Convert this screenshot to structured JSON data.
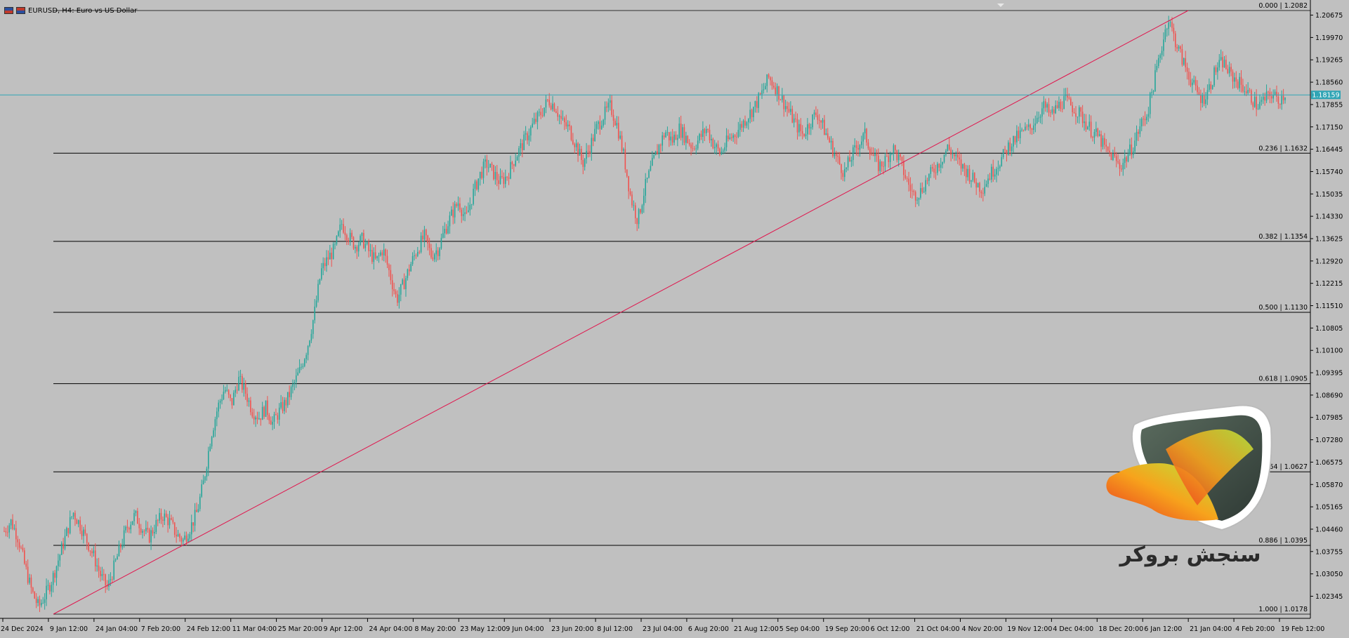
{
  "header": {
    "title": "EURUSD, H4:  Euro vs US Dollar"
  },
  "colors": {
    "background": "#c0c0c0",
    "bull_candle": "#26a69a",
    "bear_candle": "#ef5350",
    "trend_line": "#e0144c",
    "fib_line": "#000000",
    "current_price_line": "#30a5b5"
  },
  "chart_data": {
    "type": "candlestick",
    "symbol": "EURUSD",
    "timeframe": "H4",
    "ylim": [
      1.0178,
      1.2082
    ],
    "y_ticks": [
      "1.20675",
      "1.19970",
      "1.19265",
      "1.18560",
      "1.17855",
      "1.17150",
      "1.16445",
      "1.15740",
      "1.15035",
      "1.14330",
      "1.13625",
      "1.12920",
      "1.12215",
      "1.11510",
      "1.10805",
      "1.10100",
      "1.09395",
      "1.08690",
      "1.07985",
      "1.07280",
      "1.06575",
      "1.05870",
      "1.05165",
      "1.04460",
      "1.03755",
      "1.03050",
      "1.02345"
    ],
    "x_ticks": [
      "24 Dec 2024",
      "9 Jan 12:00",
      "24 Jan 04:00",
      "7 Feb 20:00",
      "24 Feb 12:00",
      "11 Mar 04:00",
      "25 Mar 20:00",
      "9 Apr 12:00",
      "24 Apr 04:00",
      "8 May 20:00",
      "23 May 12:00",
      "9 Jun 04:00",
      "23 Jun 20:00",
      "8 Jul 12:00",
      "23 Jul 04:00",
      "6 Aug 20:00",
      "21 Aug 12:00",
      "5 Sep 04:00",
      "19 Sep 20:00",
      "6 Oct 12:00",
      "21 Oct 04:00",
      "4 Nov 20:00",
      "19 Nov 12:00",
      "4 Dec 04:00",
      "18 Dec 20:00",
      "6 Jan 12:00",
      "21 Jan 04:00",
      "4 Feb 20:00",
      "19 Feb 12:00"
    ],
    "current_price": "1.18159",
    "fibonacci": [
      {
        "ratio": "0.000",
        "price": "1.2082",
        "value": 1.2082
      },
      {
        "ratio": "0.236",
        "price": "1.1632",
        "value": 1.1632
      },
      {
        "ratio": "0.382",
        "price": "1.1354",
        "value": 1.1354
      },
      {
        "ratio": "0.500",
        "price": "1.1130",
        "value": 1.113
      },
      {
        "ratio": "0.618",
        "price": "1.0905",
        "value": 1.0905
      },
      {
        "ratio": "0.764",
        "price": "1.0627",
        "value": 1.0627
      },
      {
        "ratio": "0.886",
        "price": "1.0395",
        "value": 1.0395
      },
      {
        "ratio": "1.000",
        "price": "1.0178",
        "value": 1.0178
      }
    ],
    "trend_line": {
      "from": {
        "time": "9 Jan 12:00",
        "price": 1.0178
      },
      "to": {
        "time": "21 Jan 04:00",
        "price": 1.2082
      }
    },
    "price_path": [
      [
        0,
        1.044
      ],
      [
        0.5,
        1.047
      ],
      [
        1,
        1.042
      ],
      [
        1.5,
        1.033
      ],
      [
        2,
        1.025
      ],
      [
        2.5,
        1.02
      ],
      [
        3,
        1.024
      ],
      [
        3.5,
        1.029
      ],
      [
        4,
        1.036
      ],
      [
        4.5,
        1.043
      ],
      [
        5,
        1.05
      ],
      [
        5.5,
        1.046
      ],
      [
        6,
        1.041
      ],
      [
        6.5,
        1.036
      ],
      [
        7,
        1.03
      ],
      [
        7.5,
        1.026
      ],
      [
        8,
        1.033
      ],
      [
        8.5,
        1.04
      ],
      [
        9,
        1.046
      ],
      [
        9.5,
        1.049
      ],
      [
        10,
        1.045
      ],
      [
        10.5,
        1.042
      ],
      [
        11,
        1.046
      ],
      [
        11.5,
        1.049
      ],
      [
        12,
        1.047
      ],
      [
        12.5,
        1.043
      ],
      [
        13,
        1.041
      ],
      [
        13.5,
        1.045
      ],
      [
        14,
        1.05
      ],
      [
        14.5,
        1.06
      ],
      [
        15,
        1.074
      ],
      [
        15.5,
        1.083
      ],
      [
        16,
        1.089
      ],
      [
        16.5,
        1.084
      ],
      [
        17,
        1.092
      ],
      [
        17.5,
        1.088
      ],
      [
        18,
        1.082
      ],
      [
        18.5,
        1.08
      ],
      [
        19,
        1.083
      ],
      [
        19.5,
        1.078
      ],
      [
        20,
        1.082
      ],
      [
        20.5,
        1.085
      ],
      [
        21,
        1.09
      ],
      [
        21.5,
        1.095
      ],
      [
        22,
        1.102
      ],
      [
        22.5,
        1.112
      ],
      [
        23,
        1.126
      ],
      [
        23.5,
        1.13
      ],
      [
        24,
        1.133
      ],
      [
        24.5,
        1.141
      ],
      [
        25,
        1.137
      ],
      [
        25.5,
        1.134
      ],
      [
        26,
        1.136
      ],
      [
        26.5,
        1.132
      ],
      [
        27,
        1.129
      ],
      [
        27.5,
        1.133
      ],
      [
        28,
        1.125
      ],
      [
        28.5,
        1.117
      ],
      [
        29,
        1.122
      ],
      [
        29.5,
        1.128
      ],
      [
        30,
        1.133
      ],
      [
        30.5,
        1.137
      ],
      [
        31,
        1.131
      ],
      [
        31.5,
        1.133
      ],
      [
        32,
        1.139
      ],
      [
        32.5,
        1.144
      ],
      [
        33,
        1.148
      ],
      [
        33.5,
        1.142
      ],
      [
        34,
        1.15
      ],
      [
        34.5,
        1.156
      ],
      [
        35,
        1.16
      ],
      [
        35.5,
        1.157
      ],
      [
        36,
        1.154
      ],
      [
        36.5,
        1.156
      ],
      [
        37,
        1.161
      ],
      [
        37.5,
        1.165
      ],
      [
        38,
        1.169
      ],
      [
        38.5,
        1.173
      ],
      [
        39,
        1.176
      ],
      [
        39.5,
        1.18
      ],
      [
        40,
        1.178
      ],
      [
        40.5,
        1.173
      ],
      [
        41,
        1.171
      ],
      [
        41.5,
        1.166
      ],
      [
        42,
        1.16
      ],
      [
        42.5,
        1.165
      ],
      [
        43,
        1.171
      ],
      [
        43.5,
        1.175
      ],
      [
        44,
        1.178
      ],
      [
        44.5,
        1.172
      ],
      [
        45,
        1.162
      ],
      [
        45.5,
        1.149
      ],
      [
        46,
        1.142
      ],
      [
        46.5,
        1.152
      ],
      [
        47,
        1.159
      ],
      [
        47.5,
        1.165
      ],
      [
        48,
        1.17
      ],
      [
        48.5,
        1.167
      ],
      [
        49,
        1.171
      ],
      [
        49.5,
        1.168
      ],
      [
        50,
        1.165
      ],
      [
        50.5,
        1.168
      ],
      [
        51,
        1.171
      ],
      [
        51.5,
        1.166
      ],
      [
        52,
        1.163
      ],
      [
        52.5,
        1.167
      ],
      [
        53,
        1.169
      ],
      [
        53.5,
        1.172
      ],
      [
        54,
        1.175
      ],
      [
        54.5,
        1.178
      ],
      [
        55,
        1.182
      ],
      [
        55.5,
        1.187
      ],
      [
        56,
        1.184
      ],
      [
        56.5,
        1.18
      ],
      [
        57,
        1.176
      ],
      [
        57.5,
        1.172
      ],
      [
        58,
        1.169
      ],
      [
        58.5,
        1.173
      ],
      [
        59,
        1.176
      ],
      [
        59.5,
        1.171
      ],
      [
        60,
        1.166
      ],
      [
        60.5,
        1.161
      ],
      [
        61,
        1.157
      ],
      [
        61.5,
        1.162
      ],
      [
        62,
        1.166
      ],
      [
        62.5,
        1.169
      ],
      [
        63,
        1.163
      ],
      [
        63.5,
        1.159
      ],
      [
        64,
        1.161
      ],
      [
        64.5,
        1.165
      ],
      [
        65,
        1.161
      ],
      [
        65.5,
        1.155
      ],
      [
        66,
        1.15
      ],
      [
        66.5,
        1.151
      ],
      [
        67,
        1.155
      ],
      [
        67.5,
        1.158
      ],
      [
        68,
        1.161
      ],
      [
        68.5,
        1.165
      ],
      [
        69,
        1.162
      ],
      [
        69.5,
        1.159
      ],
      [
        70,
        1.157
      ],
      [
        70.5,
        1.154
      ],
      [
        71,
        1.152
      ],
      [
        71.5,
        1.156
      ],
      [
        72,
        1.159
      ],
      [
        72.5,
        1.162
      ],
      [
        73,
        1.166
      ],
      [
        73.5,
        1.168
      ],
      [
        74,
        1.17
      ],
      [
        74.5,
        1.171
      ],
      [
        75,
        1.175
      ],
      [
        75.5,
        1.178
      ],
      [
        76,
        1.175
      ],
      [
        76.5,
        1.178
      ],
      [
        77,
        1.18
      ],
      [
        77.5,
        1.178
      ],
      [
        78,
        1.176
      ],
      [
        78.5,
        1.173
      ],
      [
        79,
        1.17
      ],
      [
        79.5,
        1.168
      ],
      [
        80,
        1.164
      ],
      [
        80.5,
        1.162
      ],
      [
        81,
        1.159
      ],
      [
        81.5,
        1.162
      ],
      [
        82,
        1.166
      ],
      [
        82.5,
        1.172
      ],
      [
        83,
        1.176
      ],
      [
        83.5,
        1.186
      ],
      [
        84,
        1.196
      ],
      [
        84.5,
        1.206
      ],
      [
        85,
        1.199
      ],
      [
        85.5,
        1.193
      ],
      [
        86,
        1.188
      ],
      [
        86.5,
        1.183
      ],
      [
        87,
        1.18
      ],
      [
        87.5,
        1.184
      ],
      [
        88,
        1.19
      ],
      [
        88.5,
        1.192
      ],
      [
        89,
        1.188
      ],
      [
        89.5,
        1.186
      ],
      [
        90,
        1.184
      ],
      [
        90.5,
        1.181
      ],
      [
        91,
        1.178
      ],
      [
        91.5,
        1.18
      ],
      [
        92,
        1.182
      ],
      [
        92.5,
        1.18
      ],
      [
        93,
        1.182
      ]
    ]
  },
  "logo": {
    "text": "سنجش بروکر"
  }
}
